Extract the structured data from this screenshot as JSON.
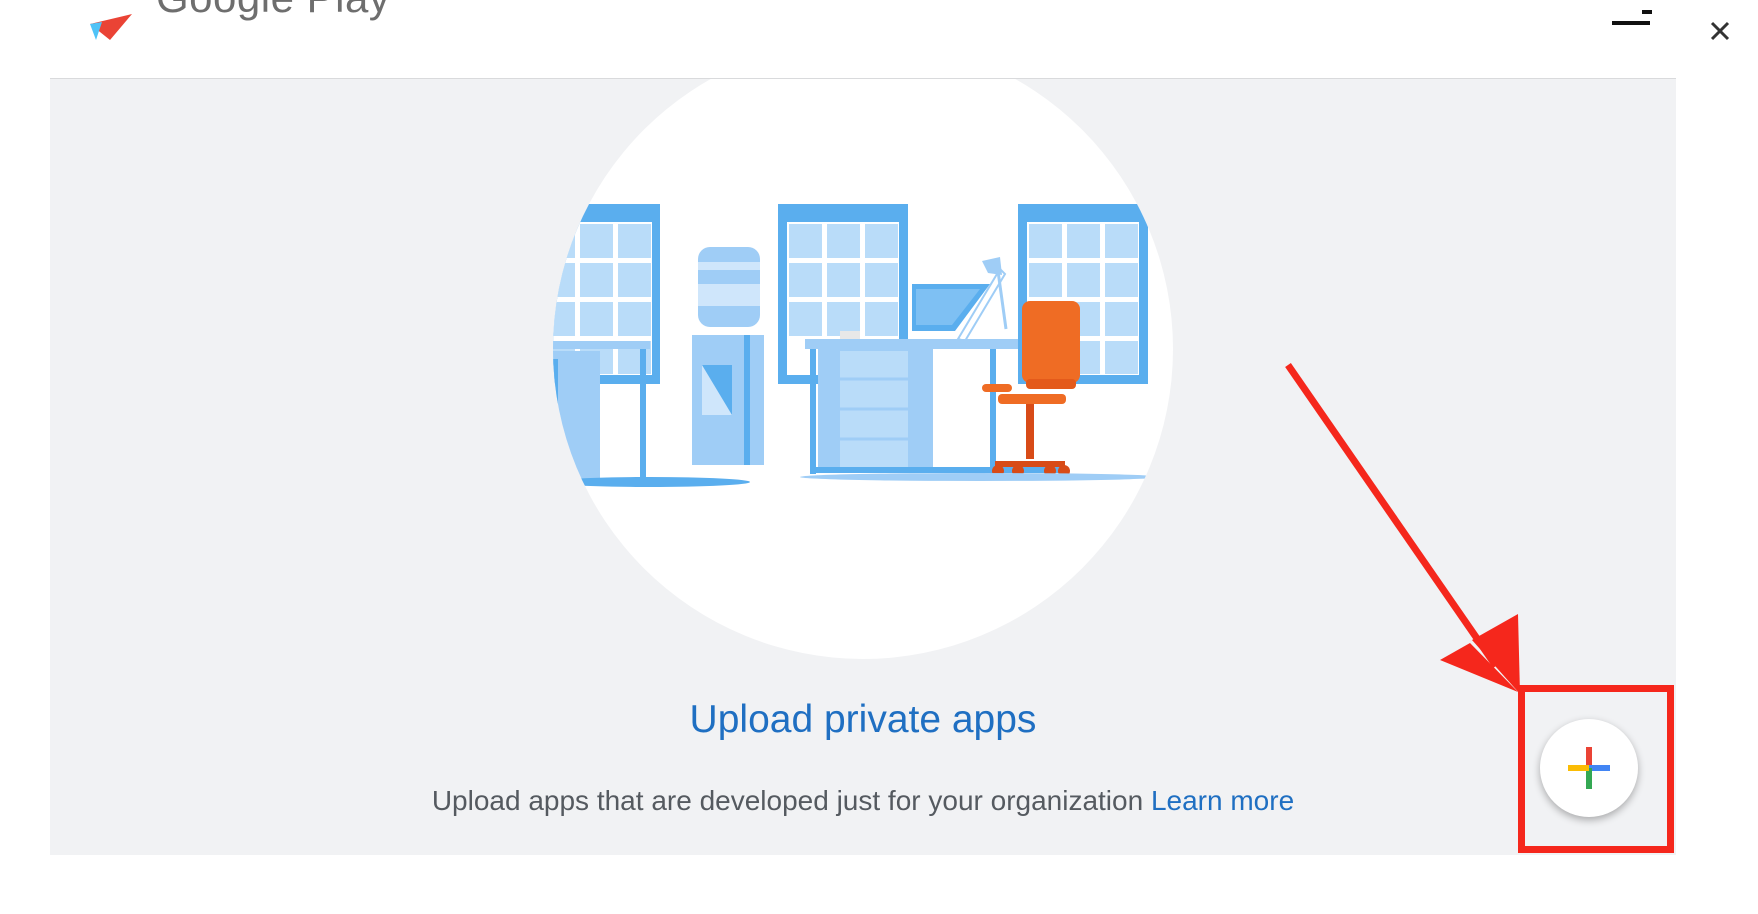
{
  "header": {
    "brand_name": "Google Play",
    "menu_icon": "menu-glyph",
    "close_icon": "close-icon"
  },
  "main": {
    "illustration": "office-illustration",
    "title": "Upload private apps",
    "subtitle": "Upload apps that are developed just for your organization",
    "learn_more_link": "Learn more"
  },
  "fab": {
    "icon": "multicolor-plus-icon",
    "colors": [
      "#ea4335",
      "#4285f4",
      "#34a853",
      "#fbbc05"
    ]
  },
  "colors": {
    "panel_background": "#f1f2f4",
    "link": "#1f6fc2",
    "annotation": "#f5271c"
  }
}
